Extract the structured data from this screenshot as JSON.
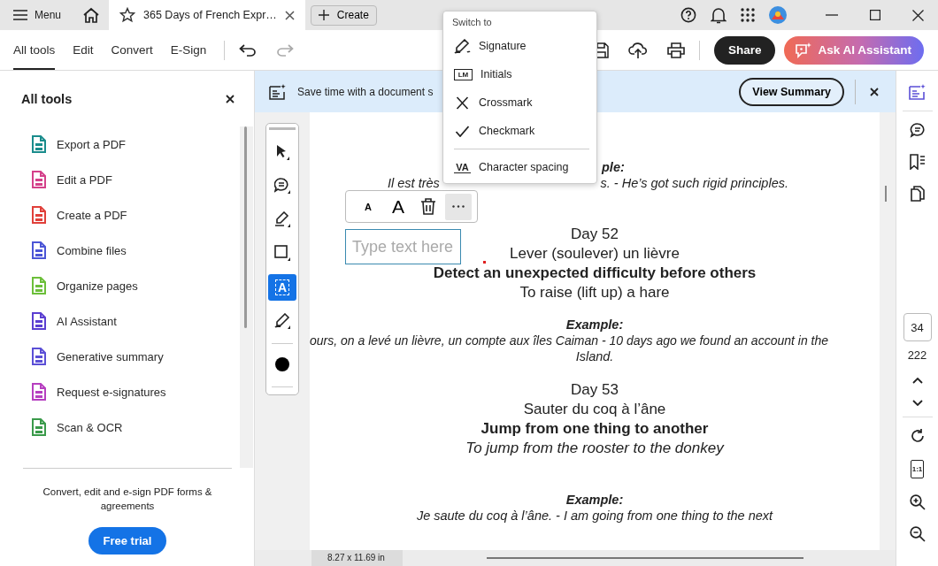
{
  "window": {
    "menu": "Menu",
    "tab_title": "365 Days of French Expr…",
    "create": "Create"
  },
  "nav_tabs": [
    {
      "label": "All tools",
      "selected": true
    },
    {
      "label": "Edit",
      "selected": false
    },
    {
      "label": "Convert",
      "selected": false
    },
    {
      "label": "E-Sign",
      "selected": false
    }
  ],
  "actions": {
    "share": "Share",
    "ai": "Ask AI Assistant"
  },
  "sidebar": {
    "title": "All tools",
    "items": [
      {
        "label": "Export a PDF",
        "color": "#1a8c8c"
      },
      {
        "label": "Edit a PDF",
        "color": "#d4418a"
      },
      {
        "label": "Create a PDF",
        "color": "#e0403a"
      },
      {
        "label": "Combine files",
        "color": "#4b55d6"
      },
      {
        "label": "Organize pages",
        "color": "#6cbf3a"
      },
      {
        "label": "AI Assistant",
        "color": "#5b3fd1"
      },
      {
        "label": "Generative summary",
        "color": "#5b4fd6"
      },
      {
        "label": "Request e-signatures",
        "color": "#b63fc0"
      },
      {
        "label": "Scan & OCR",
        "color": "#3a9a4a"
      }
    ],
    "promo": "Convert, edit and e-sign PDF forms & agreements",
    "cta": "Free trial"
  },
  "banner": {
    "text": "Save time with a document s",
    "button": "View Summary"
  },
  "tools": [
    {
      "kind": "select",
      "selected": false
    },
    {
      "kind": "comment",
      "selected": false
    },
    {
      "kind": "highlight",
      "selected": false
    },
    {
      "kind": "rectangle",
      "selected": false
    },
    {
      "kind": "text",
      "icon_text": "A",
      "selected": true
    },
    {
      "kind": "sign",
      "selected": false
    },
    {
      "kind": "color",
      "selected": false
    }
  ],
  "text_toolbar": [
    {
      "kind": "smaller",
      "text": "A",
      "selected": false
    },
    {
      "kind": "larger",
      "text": "A",
      "selected": false
    },
    {
      "kind": "delete",
      "selected": false
    },
    {
      "kind": "more",
      "selected": true
    }
  ],
  "text_field": {
    "placeholder": "Type text here"
  },
  "menu": {
    "heading": "Switch to",
    "groups": [
      [
        {
          "kind": "signature",
          "label": "Signature"
        },
        {
          "kind": "initials",
          "icon_text": "LM",
          "label": "Initials"
        },
        {
          "kind": "crossmark",
          "label": "Crossmark"
        },
        {
          "kind": "checkmark",
          "label": "Checkmark"
        }
      ],
      [
        {
          "kind": "spacing",
          "icon_text": "VA",
          "label": "Character spacing"
        }
      ]
    ]
  },
  "document": {
    "partial": {
      "label": "ple:",
      "left": "Il est très",
      "right": "s. - He’s got such rigid principles."
    },
    "lines": [
      {
        "kind": "heading",
        "text": "Day 52"
      },
      {
        "kind": "french",
        "text": "Lever (soulever) un lièvre"
      },
      {
        "kind": "meaning",
        "text": "Detect an unexpected difficulty before others"
      },
      {
        "kind": "plain",
        "text": "To raise (lift up) a hare"
      },
      {
        "kind": "example_label",
        "text": "Example:"
      },
      {
        "kind": "example_wide",
        "text": "ours, on a levé un lièvre, un compte aux îles Caiman - 10 days ago we found an account in the"
      },
      {
        "kind": "example",
        "text": "Island."
      },
      {
        "kind": "heading",
        "text": "Day 53"
      },
      {
        "kind": "french",
        "text": "Sauter du coq à l’âne"
      },
      {
        "kind": "meaning",
        "text": "Jump from one thing to another"
      },
      {
        "kind": "literal",
        "text": "To jump from the rooster to the donkey"
      },
      {
        "kind": "example_label_far",
        "text": "Example:"
      },
      {
        "kind": "example",
        "text": "Je saute du coq à l’âne. - I am going from one thing to the next"
      }
    ]
  },
  "rail": {
    "page": "34",
    "total": "222",
    "fit_text": "1:1"
  },
  "status": {
    "size": "8.27 x 11.69 in"
  }
}
